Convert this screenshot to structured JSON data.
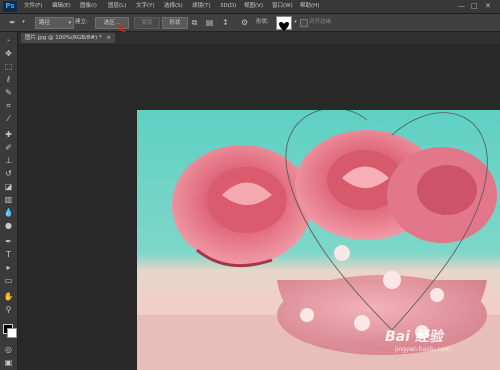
{
  "menubar": {
    "logo": "Ps",
    "items": [
      "文件(F)",
      "编辑(E)",
      "图像(I)",
      "图层(L)",
      "文字(Y)",
      "选择(S)",
      "滤镜(T)",
      "3D(D)",
      "视图(V)",
      "窗口(W)",
      "帮助(H)"
    ],
    "window_controls": [
      "—",
      "□",
      "✕"
    ]
  },
  "options": {
    "mode": "路径",
    "create_label": "建立:",
    "selection_btn": "选区...",
    "mask_btn": "蒙版",
    "shape_btn": "形状",
    "shape_label": "形状:",
    "align_edges": "对齐边缘"
  },
  "document": {
    "tab_title": "图片.jpg @ 100%(RGB/8#) *",
    "close": "×"
  },
  "watermark": {
    "brand": "Bai 经验",
    "url": "jingyan.baidu.com"
  },
  "colors": {
    "accent_arrow": "#e2231a",
    "photo_bg": "#3fc4b8",
    "rose": "#d9586a",
    "vase": "#e89aa2"
  }
}
